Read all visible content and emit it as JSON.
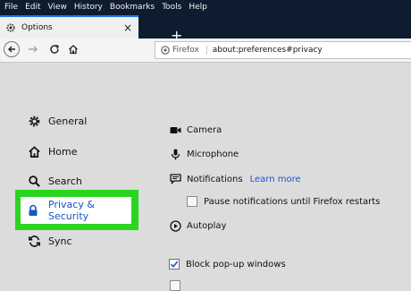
{
  "menu": [
    "File",
    "Edit",
    "View",
    "History",
    "Bookmarks",
    "Tools",
    "Help"
  ],
  "tab": {
    "title": "Options",
    "close": "×"
  },
  "new_tab": "+",
  "url_bar": {
    "identity": "Firefox",
    "url": "about:preferences#privacy"
  },
  "sidebar": {
    "items": [
      {
        "label": "General",
        "icon": "gear-icon"
      },
      {
        "label": "Home",
        "icon": "home-icon"
      },
      {
        "label": "Search",
        "icon": "search-icon"
      },
      {
        "label": "Privacy & Security",
        "icon": "lock-icon",
        "selected": true
      },
      {
        "label": "Sync",
        "icon": "sync-icon"
      }
    ]
  },
  "permissions": {
    "camera": "Camera",
    "microphone": "Microphone",
    "notifications": "Notifications",
    "learn_more": "Learn more",
    "pause_notifications": "Pause notifications until Firefox restarts",
    "autoplay": "Autoplay",
    "block_popups": "Block pop-up windows"
  },
  "colors": {
    "accent": "#1a55c9",
    "highlight": "#2bd41f",
    "titlebar": "#0d1c2e",
    "page_bg": "#dcdcdc"
  }
}
